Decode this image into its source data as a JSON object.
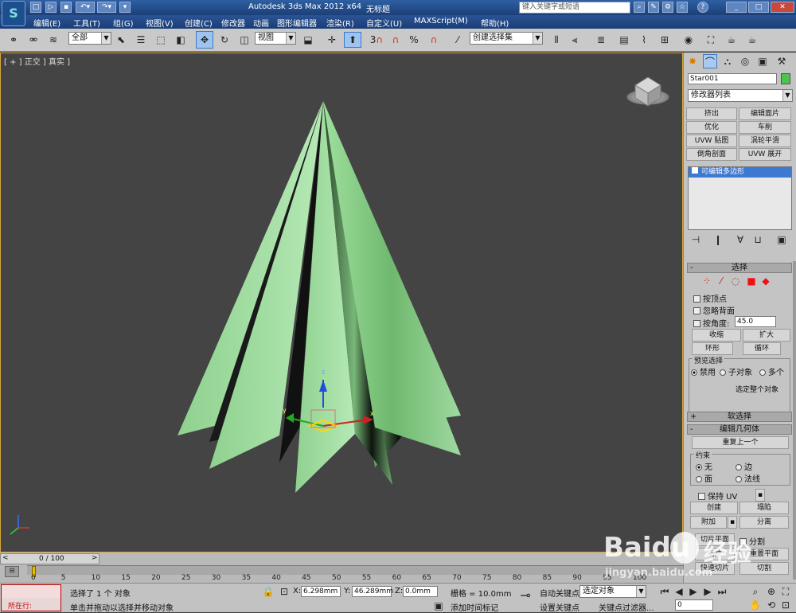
{
  "title": {
    "app": "Autodesk 3ds Max  2012 x64",
    "doc": "无标题",
    "search_placeholder": "键入关键字或短语"
  },
  "menus": [
    "编辑(E)",
    "工具(T)",
    "组(G)",
    "视图(V)",
    "创建(C)",
    "修改器",
    "动画",
    "图形编辑器",
    "渲染(R)",
    "自定义(U)",
    "MAXScript(M)",
    "帮助(H)"
  ],
  "toolbar": {
    "selection_filter": "全部",
    "ref_coord": "视图",
    "named_selection": "创建选择集",
    "snap_label": "3"
  },
  "viewport": {
    "label": "[ + ] 正交 ] 真实 ]",
    "axis_x": "x",
    "axis_y": "y",
    "axis_z": "z"
  },
  "panel": {
    "object_name": "Star001",
    "object_color": "#4fc34f",
    "modifier_list": "修改器列表",
    "modifier_buttons": [
      [
        "挤出",
        "编辑面片"
      ],
      [
        "优化",
        "车削"
      ],
      [
        "UVW 贴图",
        "涡轮平滑"
      ],
      [
        "倒角剖面",
        "UVW 展开"
      ]
    ],
    "stack_item": "可编辑多边形",
    "selection": {
      "header": "选择",
      "by_vertex": "按顶点",
      "ignore_backface": "忽略背面",
      "by_angle": "按角度:",
      "angle_value": "45.0",
      "shrink": "收缩",
      "grow": "扩大",
      "ring": "环形",
      "loop": "循环",
      "preview_group": "预览选择",
      "preview_options": [
        "禁用",
        "子对象",
        "多个"
      ],
      "status": "选定整个对象"
    },
    "soft_selection": "软选择",
    "edit_geometry": {
      "header": "编辑几何体",
      "repeat_last": "重复上一个",
      "constraints_group": "约束",
      "constraints": [
        "无",
        "边",
        "面",
        "法线"
      ],
      "preserve_uv": "保持 UV",
      "create": "创建",
      "collapse": "塌陷",
      "attach": "附加",
      "detach": "分离",
      "slice_plane": "切片平面",
      "split": "分割",
      "slice": "切片",
      "reset_plane": "重置平面",
      "quickslice": "快速切片",
      "cut": "切割"
    }
  },
  "timeline": {
    "frame_label": "0 / 100",
    "ticks": [
      "0",
      "5",
      "10",
      "15",
      "20",
      "25",
      "30",
      "35",
      "40",
      "45",
      "50",
      "55",
      "60",
      "65",
      "70",
      "75",
      "80",
      "85",
      "90",
      "95",
      "100"
    ]
  },
  "status": {
    "running": "所在行:",
    "selected": "选择了 1 个 对象",
    "prompt": "单击并拖动以选择并移动对象",
    "x_label": "X:",
    "x_value": "6.298mm",
    "y_label": "Y:",
    "y_value": "46.289mm",
    "z_label": "Z:",
    "z_value": "0.0mm",
    "grid": "栅格 = 10.0mm",
    "add_time_tag": "添加时间标记",
    "auto_key": "自动关键点",
    "set_key": "设置关键点",
    "selected_object": "选定对象",
    "key_filters": "关键点过滤器...",
    "frame": "0"
  },
  "watermark": {
    "brand": "Baidu",
    "text": "经验",
    "url": "jingyan.baidu.com"
  }
}
